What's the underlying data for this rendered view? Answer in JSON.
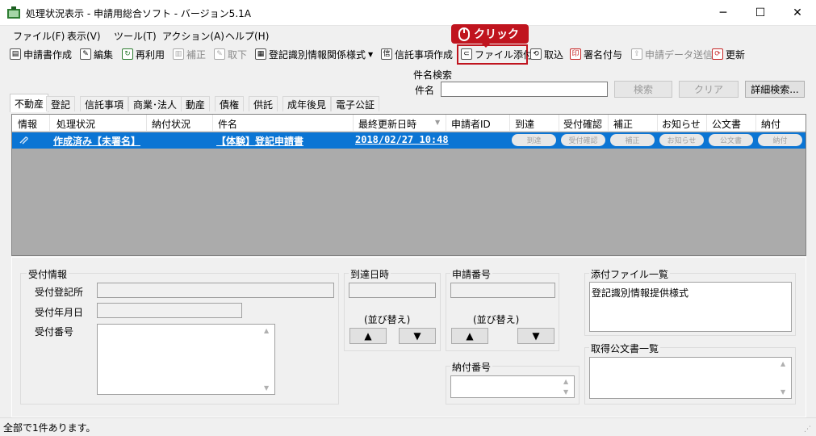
{
  "window": {
    "title": "処理状況表示 - 申請用総合ソフト - バージョン5.1A",
    "minimize": "─",
    "maximize": "☐",
    "close": "✕"
  },
  "menu": [
    "ファイル(F)",
    "表示(V)",
    "ツール(T)",
    "アクション(A)",
    "ヘルプ(H)"
  ],
  "toolbar": {
    "create_application": "申請書作成",
    "edit": "編集",
    "reuse": "再利用",
    "correction": "補正",
    "withdraw": "取下",
    "registration_form": "登記識別情報関係様式",
    "trust_creation": "信託事項作成",
    "file_attach": "ファイル添付",
    "import": "取込",
    "signature": "署名付与",
    "send_data": "申請データ送信",
    "refresh": "更新"
  },
  "callout": {
    "label": "クリック"
  },
  "search": {
    "group_label": "件名検索",
    "field_label": "件名",
    "value": "",
    "search_button": "検索",
    "clear_button": "クリア",
    "advanced_button": "詳細検索..."
  },
  "tabs": [
    "不動産",
    "登記",
    "信託事項",
    "商業･法人",
    "動産",
    "債権",
    "供託",
    "成年後見",
    "電子公証"
  ],
  "active_tab": "不動産",
  "table": {
    "columns": [
      "情報",
      "処理状況",
      "納付状況",
      "件名",
      "最終更新日時",
      "申請者ID",
      "到達",
      "受付確認",
      "補正",
      "お知らせ",
      "公文書",
      "納付"
    ],
    "rows": [
      {
        "status": "作成済み【未署名】",
        "payment": "",
        "subject": "【体験】登記申請書",
        "updated": "2018/02/27 10:48",
        "applicant": "",
        "arrival_btn": "到達",
        "receipt_btn": "受付確認",
        "correction_btn": "補正",
        "notice_btn": "お知らせ",
        "document_btn": "公文書",
        "payment_btn": "納付"
      }
    ]
  },
  "details": {
    "reception_group": "受付情報",
    "reception_office_label": "受付登記所",
    "reception_date_label": "受付年月日",
    "reception_number_label": "受付番号",
    "arrival_group": "到達日時",
    "arrival_sort": "(並び替え)",
    "application_group": "申請番号",
    "application_sort": "(並び替え)",
    "payment_group": "納付番号",
    "attached_files_group": "添付ファイル一覧",
    "attached_files": [
      "登記識別情報提供様式"
    ],
    "documents_group": "取得公文書一覧"
  },
  "status": {
    "text": "全部で1件あります。"
  },
  "colors": {
    "selected_row": "#0b75d4",
    "callout": "#c0141e"
  }
}
